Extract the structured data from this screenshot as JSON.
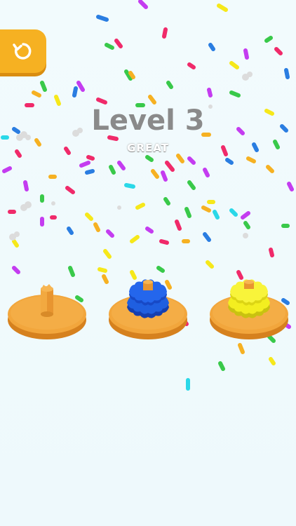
{
  "level": {
    "label": "Level 3",
    "subtitle": "GREAT"
  },
  "controls": {
    "restart_icon": "restart-icon"
  },
  "colors": {
    "background": "#f2fbfd",
    "button": "#f6b122",
    "base": "#f2a63c",
    "blue_gear": "#1f5fe0",
    "yellow_gear": "#f6f21e",
    "title": "#8a8a8a"
  },
  "towers": [
    {
      "name": "tower-1",
      "pieces": 0
    },
    {
      "name": "tower-2",
      "pieces": 2,
      "piece_color": "blue"
    },
    {
      "name": "tower-3",
      "pieces": 2,
      "piece_color": "yellow"
    }
  ]
}
